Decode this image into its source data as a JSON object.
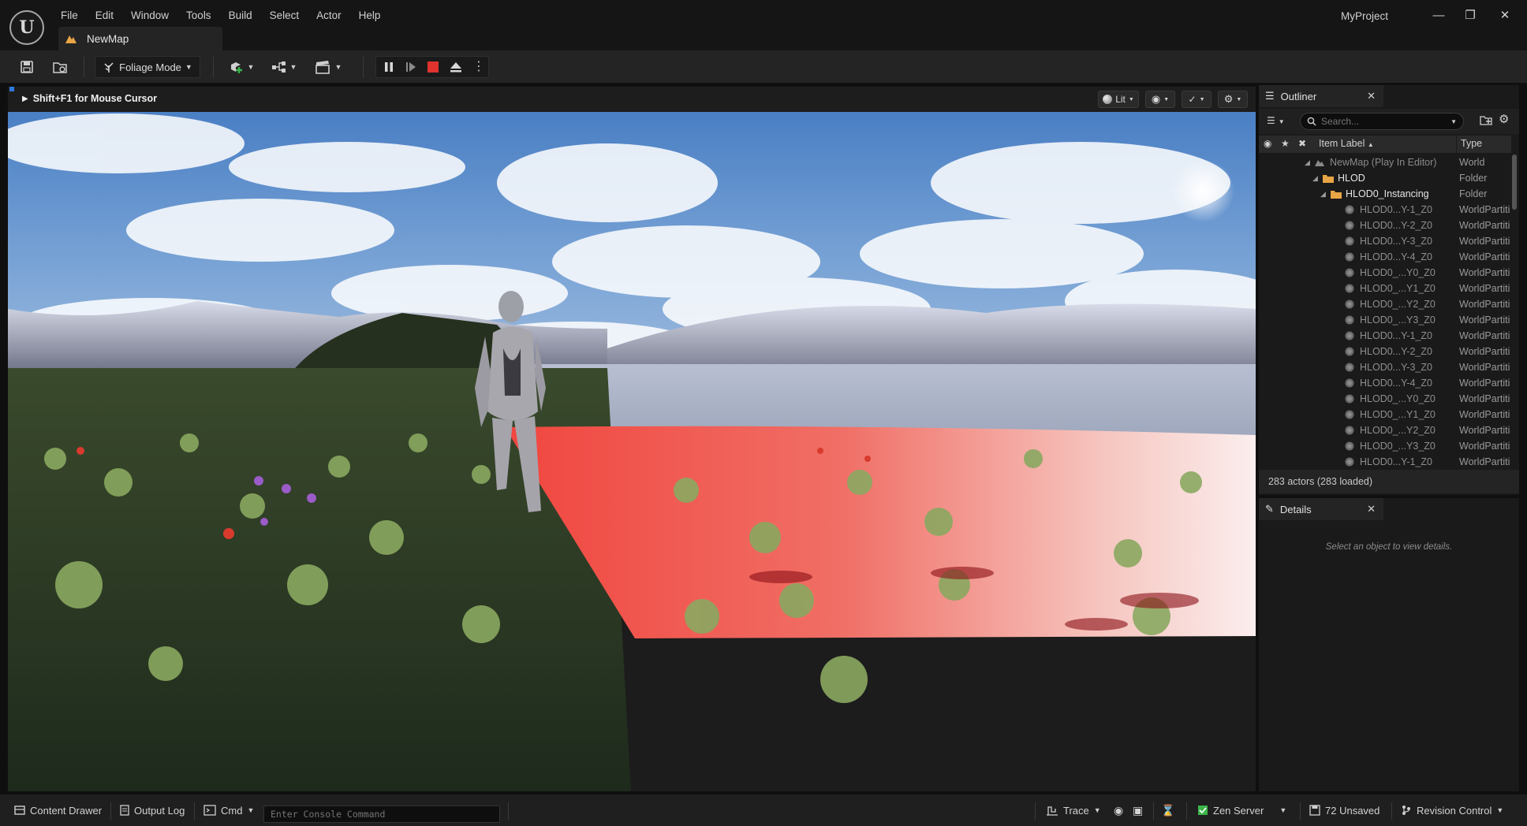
{
  "app": {
    "project_name": "MyProject",
    "map_tab": "NewMap"
  },
  "menu": [
    "File",
    "Edit",
    "Window",
    "Tools",
    "Build",
    "Select",
    "Actor",
    "Help"
  ],
  "toolbar": {
    "mode_label": "Foliage Mode"
  },
  "viewport": {
    "hint": "Shift+F1 for Mouse Cursor",
    "view_mode": "Lit"
  },
  "outliner": {
    "title": "Outliner",
    "search_placeholder": "Search...",
    "col_label": "Item Label",
    "col_type": "Type",
    "rows": [
      {
        "label": "NewMap (Play In Editor)",
        "type": "World",
        "indent": 0,
        "kind": "world"
      },
      {
        "label": "HLOD",
        "type": "Folder",
        "indent": 1,
        "kind": "folder"
      },
      {
        "label": "HLOD0_Instancing",
        "type": "Folder",
        "indent": 2,
        "kind": "folder"
      },
      {
        "label": "HLOD0...Y-1_Z0",
        "type": "WorldPartiti",
        "indent": 3,
        "kind": "actor"
      },
      {
        "label": "HLOD0...Y-2_Z0",
        "type": "WorldPartiti",
        "indent": 3,
        "kind": "actor"
      },
      {
        "label": "HLOD0...Y-3_Z0",
        "type": "WorldPartiti",
        "indent": 3,
        "kind": "actor"
      },
      {
        "label": "HLOD0...Y-4_Z0",
        "type": "WorldPartiti",
        "indent": 3,
        "kind": "actor"
      },
      {
        "label": "HLOD0_...Y0_Z0",
        "type": "WorldPartiti",
        "indent": 3,
        "kind": "actor"
      },
      {
        "label": "HLOD0_...Y1_Z0",
        "type": "WorldPartiti",
        "indent": 3,
        "kind": "actor"
      },
      {
        "label": "HLOD0_...Y2_Z0",
        "type": "WorldPartiti",
        "indent": 3,
        "kind": "actor"
      },
      {
        "label": "HLOD0_...Y3_Z0",
        "type": "WorldPartiti",
        "indent": 3,
        "kind": "actor"
      },
      {
        "label": "HLOD0...Y-1_Z0",
        "type": "WorldPartiti",
        "indent": 3,
        "kind": "actor"
      },
      {
        "label": "HLOD0...Y-2_Z0",
        "type": "WorldPartiti",
        "indent": 3,
        "kind": "actor"
      },
      {
        "label": "HLOD0...Y-3_Z0",
        "type": "WorldPartiti",
        "indent": 3,
        "kind": "actor"
      },
      {
        "label": "HLOD0...Y-4_Z0",
        "type": "WorldPartiti",
        "indent": 3,
        "kind": "actor"
      },
      {
        "label": "HLOD0_...Y0_Z0",
        "type": "WorldPartiti",
        "indent": 3,
        "kind": "actor"
      },
      {
        "label": "HLOD0_...Y1_Z0",
        "type": "WorldPartiti",
        "indent": 3,
        "kind": "actor"
      },
      {
        "label": "HLOD0_...Y2_Z0",
        "type": "WorldPartiti",
        "indent": 3,
        "kind": "actor"
      },
      {
        "label": "HLOD0_...Y3_Z0",
        "type": "WorldPartiti",
        "indent": 3,
        "kind": "actor"
      },
      {
        "label": "HLOD0...Y-1_Z0",
        "type": "WorldPartiti",
        "indent": 3,
        "kind": "actor"
      }
    ],
    "footer": "283 actors (283 loaded)"
  },
  "details": {
    "title": "Details",
    "empty_text": "Select an object to view details."
  },
  "statusbar": {
    "content_drawer": "Content Drawer",
    "output_log": "Output Log",
    "cmd": "Cmd",
    "console_placeholder": "Enter Console Command",
    "trace": "Trace",
    "zen_server": "Zen Server",
    "unsaved": "72 Unsaved",
    "revision_control": "Revision Control"
  },
  "colors": {
    "accent_red": "#e0322e",
    "folder": "#e8a546",
    "zen_green": "#3bb54a"
  }
}
